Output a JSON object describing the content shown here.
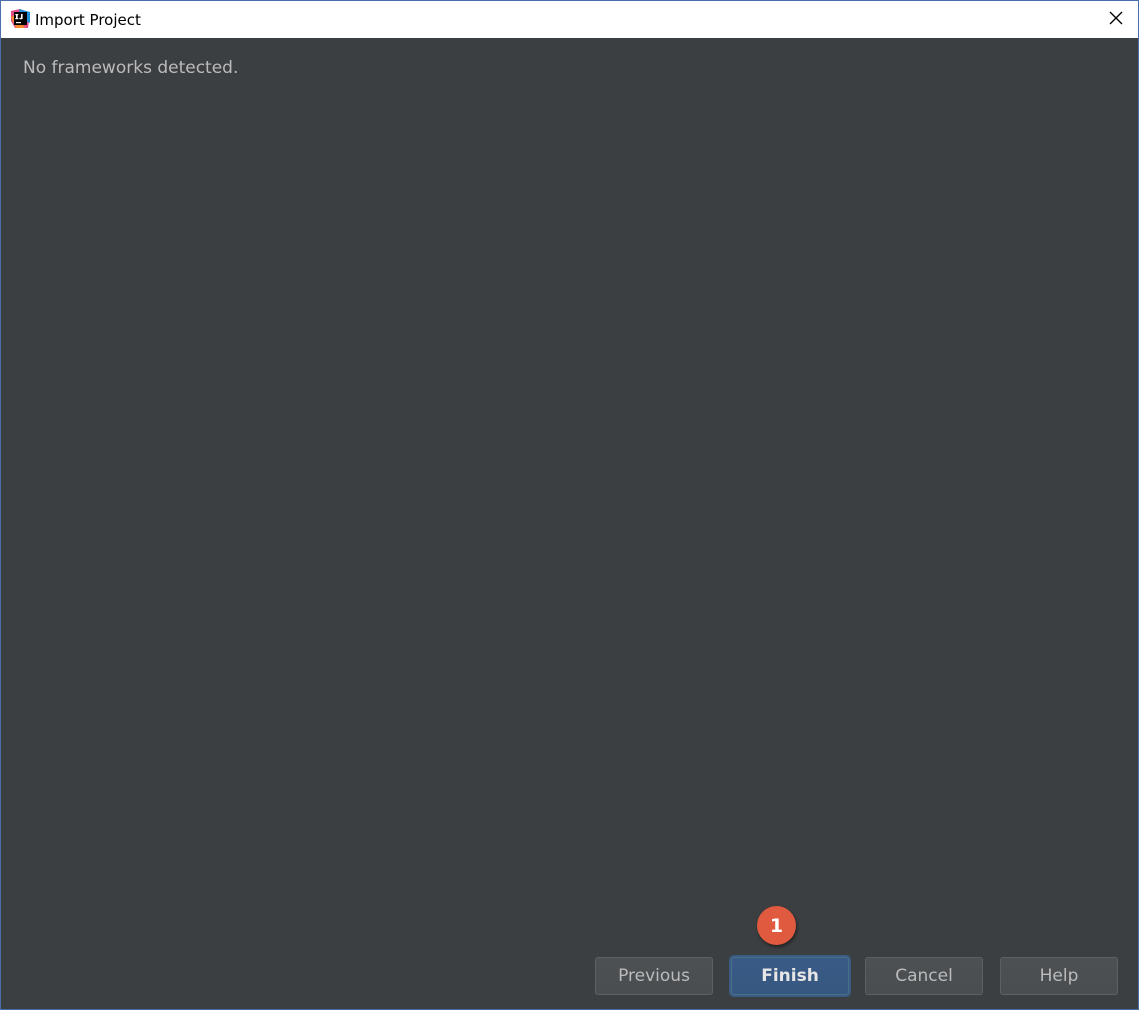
{
  "window": {
    "title": "Import Project",
    "app_icon": "intellij-idea-icon",
    "close_icon": "close-icon"
  },
  "content": {
    "message": "No frameworks detected."
  },
  "annotation": {
    "step_number": "1",
    "color": "#e05a3f"
  },
  "buttons": {
    "previous": "Previous",
    "finish": "Finish",
    "cancel": "Cancel",
    "help": "Help"
  },
  "colors": {
    "background": "#3c3f41",
    "primary_button": "#365880",
    "text": "#bbbbbb"
  }
}
